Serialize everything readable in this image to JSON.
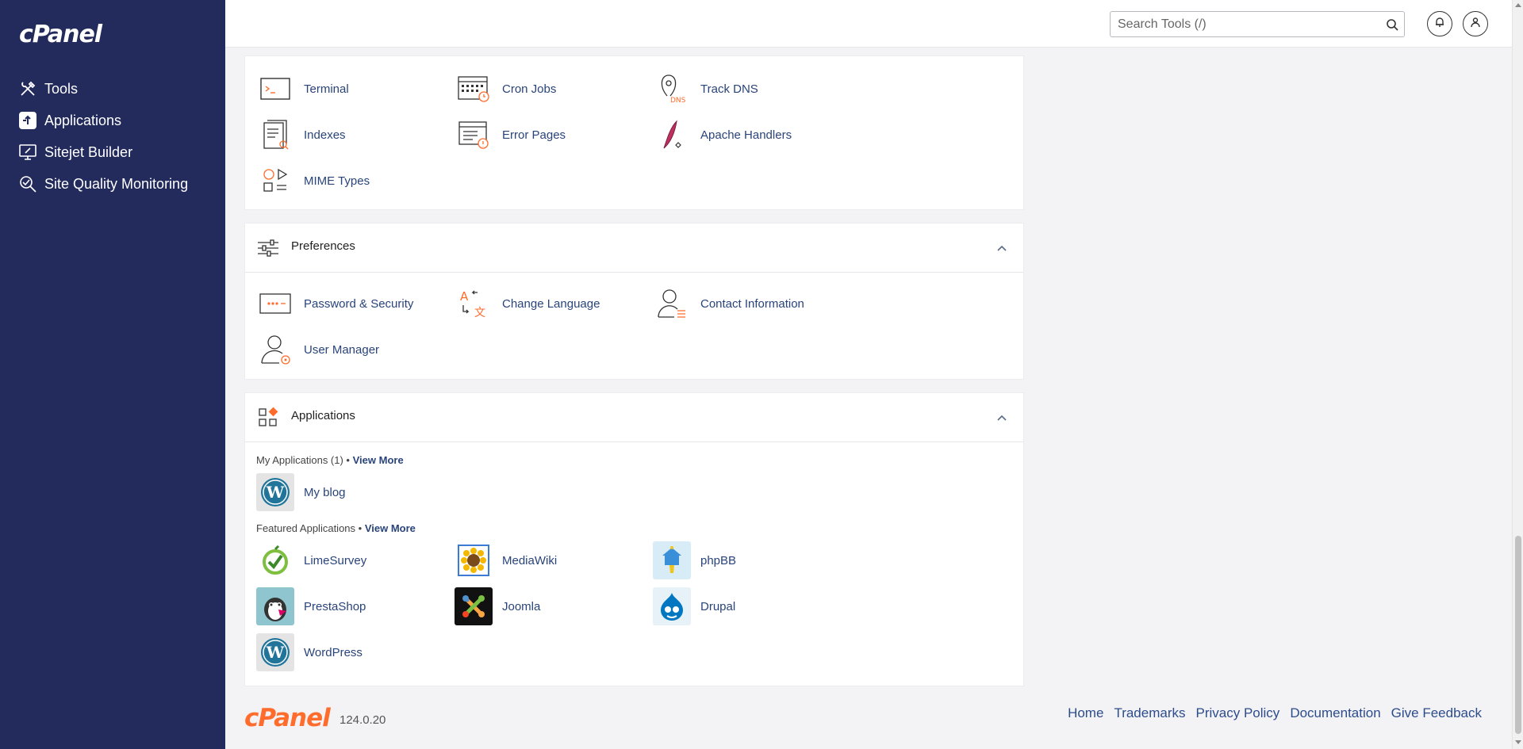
{
  "sidebar": {
    "logo": "cPanel",
    "items": [
      {
        "label": "Tools",
        "icon": "tools-icon"
      },
      {
        "label": "Applications",
        "icon": "applications-icon"
      },
      {
        "label": "Sitejet Builder",
        "icon": "sitejet-icon"
      },
      {
        "label": "Site Quality Monitoring",
        "icon": "site-quality-icon"
      }
    ]
  },
  "topbar": {
    "search_placeholder": "Search Tools (/)"
  },
  "advanced": {
    "items": [
      "Terminal",
      "Cron Jobs",
      "Track DNS",
      "Indexes",
      "Error Pages",
      "Apache Handlers",
      "MIME Types"
    ]
  },
  "preferences": {
    "title": "Preferences",
    "items": [
      "Password & Security",
      "Change Language",
      "Contact Information",
      "User Manager"
    ]
  },
  "applications": {
    "title": "Applications",
    "my_apps_label": "My Applications (1) • ",
    "my_apps_link": "View More",
    "my_apps": [
      "My blog"
    ],
    "featured_label": "Featured Applications • ",
    "featured_link": "View More",
    "featured": [
      "LimeSurvey",
      "MediaWiki",
      "phpBB",
      "PrestaShop",
      "Joomla",
      "Drupal",
      "WordPress"
    ]
  },
  "footer": {
    "logo": "cPanel",
    "version": "124.0.20",
    "links": [
      "Home",
      "Trademarks",
      "Privacy Policy",
      "Documentation",
      "Give Feedback"
    ]
  },
  "colors": {
    "sidebar_bg": "#232a5c",
    "link": "#29447a",
    "accent_orange": "#ff6c2c"
  }
}
